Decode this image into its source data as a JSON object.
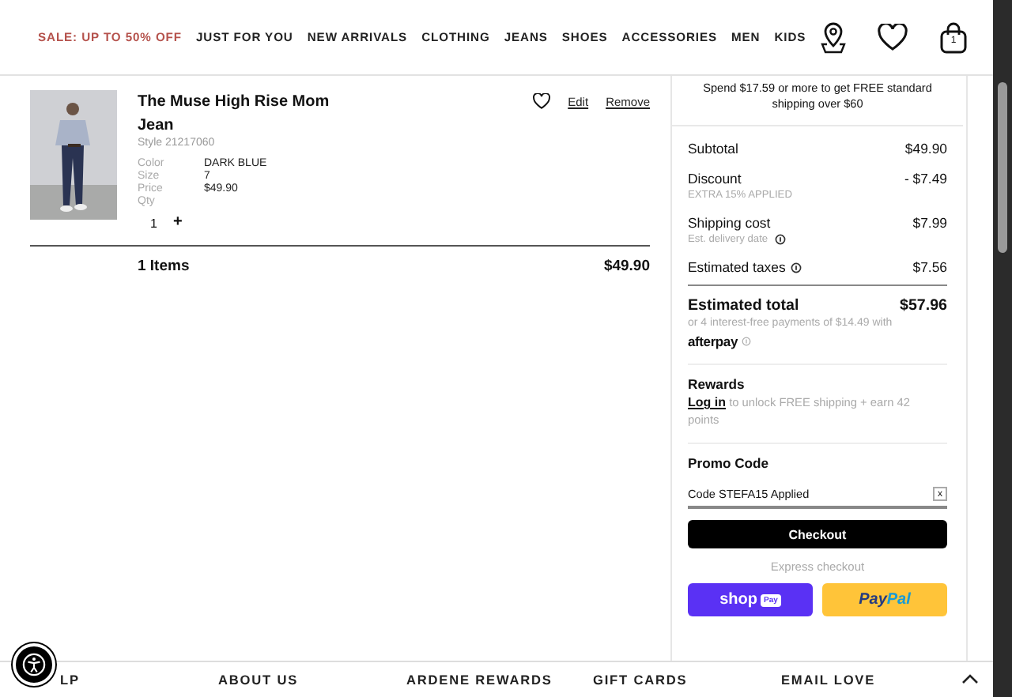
{
  "nav": {
    "items": [
      {
        "label": "SALE: UP TO 50% OFF",
        "kind": "sale"
      },
      {
        "label": "JUST FOR YOU",
        "kind": "normal"
      },
      {
        "label": "NEW ARRIVALS",
        "kind": "normal"
      },
      {
        "label": "CLOTHING",
        "kind": "normal"
      },
      {
        "label": "JEANS",
        "kind": "normal"
      },
      {
        "label": "SHOES",
        "kind": "normal"
      },
      {
        "label": "ACCESSORIES",
        "kind": "normal"
      },
      {
        "label": "MEN",
        "kind": "normal"
      },
      {
        "label": "KIDS",
        "kind": "normal"
      }
    ],
    "bag_count": "1"
  },
  "cart_item": {
    "title": "The Muse High Rise Mom Jean",
    "style": "Style 21217060",
    "details": [
      {
        "label": "Color",
        "value": "DARK BLUE"
      },
      {
        "label": "Size",
        "value": "7"
      },
      {
        "label": "Price",
        "value": "$49.90"
      },
      {
        "label": "Qty"
      }
    ],
    "qty": "1",
    "increment": "+",
    "edit": "Edit",
    "remove": "Remove"
  },
  "cart_total": {
    "count": "1 Items",
    "total": "$49.90"
  },
  "summary": {
    "shipping_notice": "Spend $17.59 or more to get FREE standard shipping over $60",
    "lines": [
      {
        "label": "Subtotal",
        "value": "$49.90",
        "info": false
      },
      {
        "label": "Discount",
        "value": "- $7.49",
        "sub": "EXTRA 15% APPLIED",
        "info": false
      },
      {
        "label": "Shipping cost",
        "value": "$7.99",
        "sub": "Est. delivery date",
        "info": true
      },
      {
        "label": "Estimated taxes",
        "value": "$7.56",
        "info": true
      }
    ],
    "total": {
      "label": "Estimated total",
      "value": "$57.96"
    },
    "installments": "or 4 interest-free payments of $14.49 with",
    "afterpay": "afterpay",
    "rewards": {
      "title": "Rewards",
      "link": "Log in",
      "text": "to unlock FREE shipping + earn 42 points"
    },
    "promo": {
      "title": "Promo Code",
      "value": "Code STEFA15 Applied",
      "clear": "x"
    },
    "checkout": "Checkout",
    "express": "Express checkout",
    "shop_pay": {
      "word": "shop",
      "badge": "Pay"
    },
    "paypal": {
      "first": "Pay",
      "second": "Pal"
    }
  },
  "footer": {
    "links": [
      "LP",
      "ABOUT US",
      "ARDENE REWARDS",
      "GIFT CARDS",
      "EMAIL LOVE"
    ]
  }
}
